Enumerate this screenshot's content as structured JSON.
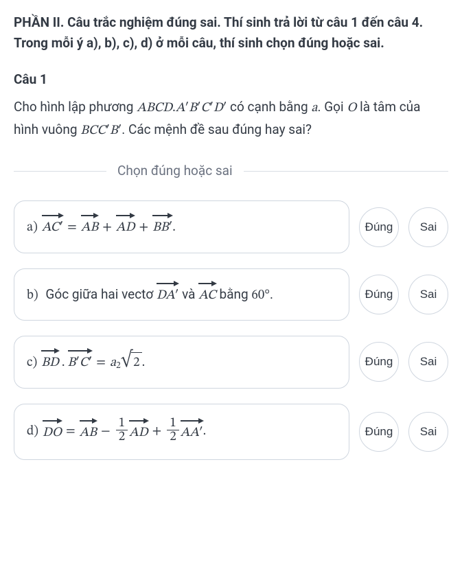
{
  "section_header": "PHẦN II. Câu trắc nghiệm đúng sai. Thí sinh trả lời từ câu 1 đến câu 4. Trong mỗi ý a), b), c), d) ở mỗi câu, thí sinh chọn đúng hoặc sai.",
  "question": {
    "label": "Câu 1",
    "body_pre": "Cho hình lập phương ",
    "body_cube": "ABCD.A′B′C′D′",
    "body_mid1": " có cạnh bằng ",
    "body_a": "a",
    "body_mid2": ". Gọi ",
    "body_O": "O",
    "body_mid3": " là tâm của hình vuông ",
    "body_square": "BCC′B′",
    "body_end": ". Các mệnh đề sau đúng hay sai?"
  },
  "instruction": "Chọn đúng hoặc sai",
  "buttons": {
    "true": "Đúng",
    "false": "Sai"
  },
  "items": {
    "a": {
      "letter": "a)",
      "lhs": "AC′",
      "eq": "=",
      "t1": "AB",
      "plus1": "+",
      "t2": "AD",
      "plus2": "+",
      "t3": "BB′",
      "end": "."
    },
    "b": {
      "letter": "b)",
      "pre": " Góc giữa hai vectơ ",
      "v1": "DA′",
      "mid": " và ",
      "v2": "AC",
      "post": " bằng ",
      "angle": "60",
      "deg": "°",
      "end": "."
    },
    "c": {
      "letter": "c)",
      "v1": "BD",
      "dot": ".",
      "v2": "B′C′",
      "eq": "=",
      "a": "a",
      "sq": "2",
      "rad": "2",
      "end": "."
    },
    "d": {
      "letter": "d)",
      "lhs": "DO",
      "eq": "=",
      "t1": "AB",
      "minus": "−",
      "f1n": "1",
      "f1d": "2",
      "t2": "AD",
      "plus": "+",
      "f2n": "1",
      "f2d": "2",
      "t3": "AA′",
      "end": "."
    }
  }
}
